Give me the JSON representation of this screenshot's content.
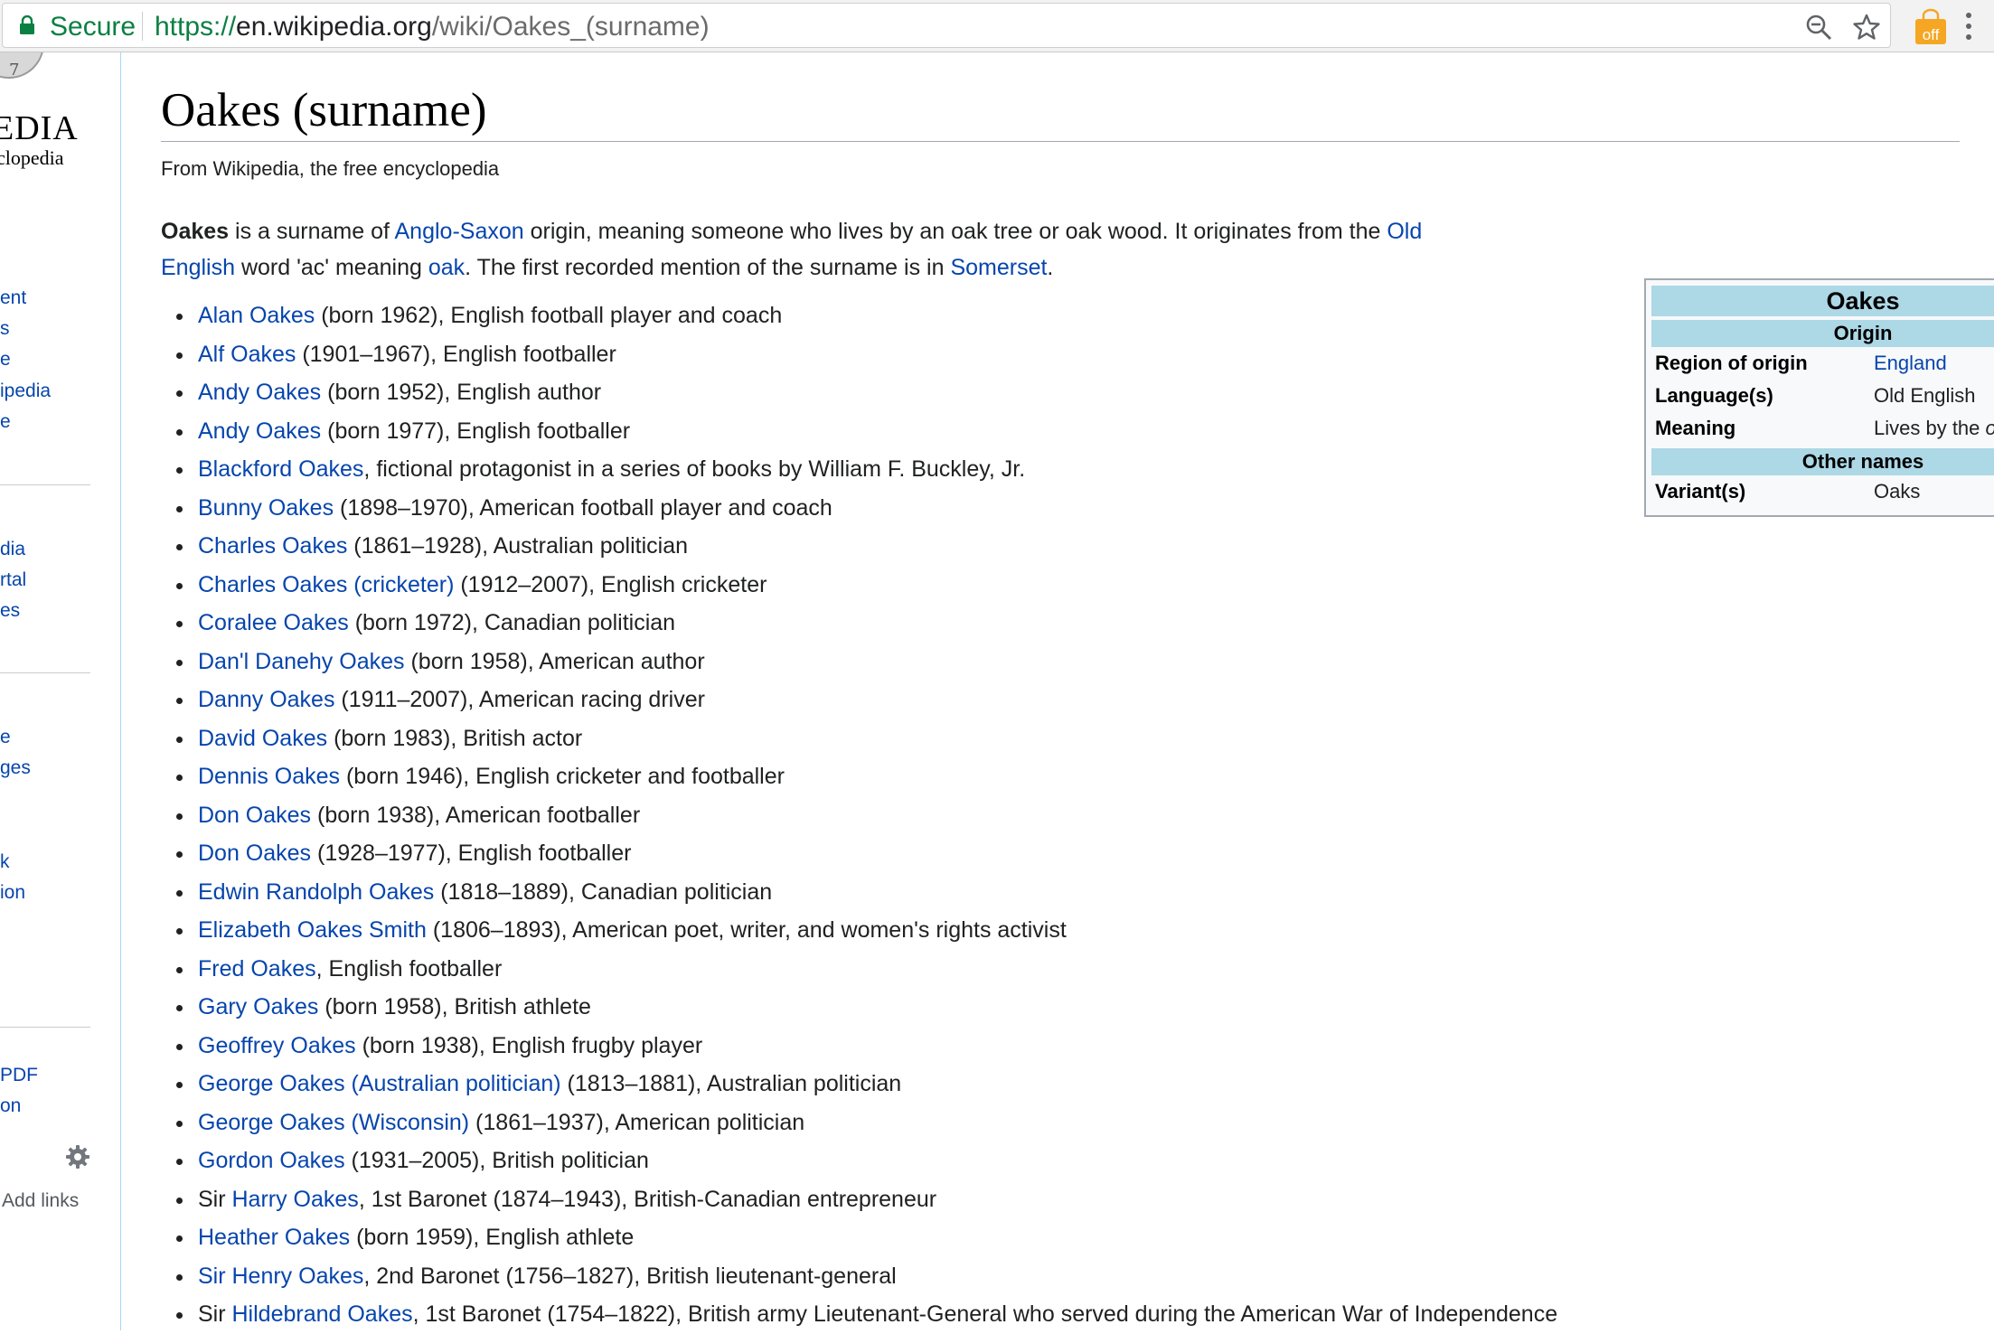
{
  "browser": {
    "secure_label": "Secure",
    "url_scheme": "https://",
    "url_host": "en.wikipedia.org",
    "url_path": "/wiki/Oakes_(surname)",
    "extension_badge": "off",
    "colors": {
      "secure": "#0b8043",
      "extension": "#f5a623"
    }
  },
  "sidebar": {
    "logo_word": "EDIA",
    "logo_tagline": "clopedia",
    "links": [
      "ent",
      "s",
      "e",
      "ipedia",
      "e",
      "dia",
      "rtal",
      "es",
      "e",
      "ges",
      "k",
      "ion",
      "PDF",
      "on"
    ],
    "grey_items": [
      "",
      "Add links"
    ]
  },
  "article": {
    "title": "Oakes (surname)",
    "site_sub": "From Wikipedia, the free encyclopedia",
    "intro": {
      "bold": "Oakes",
      "t1": " is a surname of ",
      "l1": "Anglo-Saxon",
      "t2": " origin, meaning someone who lives by an oak tree or oak wood. It originates from the ",
      "l2": "Old English",
      "t3": " word 'ac' meaning ",
      "l3": "oak",
      "t4": ". The first recorded mention of the surname is in ",
      "l4": "Somerset",
      "t5": "."
    },
    "people": [
      {
        "pre": "",
        "link": "Alan Oakes",
        "rest": " (born 1962), English football player and coach"
      },
      {
        "pre": "",
        "link": "Alf Oakes",
        "rest": " (1901–1967), English footballer"
      },
      {
        "pre": "",
        "link": "Andy Oakes",
        "rest": " (born 1952), English author"
      },
      {
        "pre": "",
        "link": "Andy Oakes",
        "rest": " (born 1977), English footballer"
      },
      {
        "pre": "",
        "link": "Blackford Oakes",
        "rest": ", fictional protagonist in a series of books by William F. Buckley, Jr."
      },
      {
        "pre": "",
        "link": "Bunny Oakes",
        "rest": " (1898–1970), American football player and coach"
      },
      {
        "pre": "",
        "link": "Charles Oakes",
        "rest": " (1861–1928), Australian politician"
      },
      {
        "pre": "",
        "link": "Charles Oakes (cricketer)",
        "rest": " (1912–2007), English cricketer"
      },
      {
        "pre": "",
        "link": "Coralee Oakes",
        "rest": " (born 1972), Canadian politician"
      },
      {
        "pre": "",
        "link": "Dan'l Danehy Oakes",
        "rest": " (born 1958), American author"
      },
      {
        "pre": "",
        "link": "Danny Oakes",
        "rest": " (1911–2007), American racing driver"
      },
      {
        "pre": "",
        "link": "David Oakes",
        "rest": " (born 1983), British actor"
      },
      {
        "pre": "",
        "link": "Dennis Oakes",
        "rest": " (born 1946), English cricketer and footballer"
      },
      {
        "pre": "",
        "link": "Don Oakes",
        "rest": " (born 1938), American footballer"
      },
      {
        "pre": "",
        "link": "Don Oakes",
        "rest": " (1928–1977), English footballer"
      },
      {
        "pre": "",
        "link": "Edwin Randolph Oakes",
        "rest": " (1818–1889), Canadian politician"
      },
      {
        "pre": "",
        "link": "Elizabeth Oakes Smith",
        "rest": " (1806–1893), American poet, writer, and women's rights activist"
      },
      {
        "pre": "",
        "link": "Fred Oakes",
        "rest": ", English footballer"
      },
      {
        "pre": "",
        "link": "Gary Oakes",
        "rest": " (born 1958), British athlete"
      },
      {
        "pre": "",
        "link": "Geoffrey Oakes",
        "rest": " (born 1938), English frugby player"
      },
      {
        "pre": "",
        "link": "George Oakes (Australian politician)",
        "rest": " (1813–1881), Australian politician"
      },
      {
        "pre": "",
        "link": "George Oakes (Wisconsin)",
        "rest": " (1861–1937), American politician"
      },
      {
        "pre": "",
        "link": "Gordon Oakes",
        "rest": " (1931–2005), British politician"
      },
      {
        "pre": "Sir ",
        "link": "Harry Oakes",
        "rest": ", 1st Baronet (1874–1943), British-Canadian entrepreneur"
      },
      {
        "pre": "",
        "link": "Heather Oakes",
        "rest": " (born 1959), English athlete"
      },
      {
        "pre": "",
        "link": "Sir Henry Oakes",
        "rest": ", 2nd Baronet (1756–1827), British lieutenant-general"
      },
      {
        "pre": "Sir ",
        "link": "Hildebrand Oakes",
        "rest": ", 1st Baronet (1754–1822), British army Lieutenant-General who served during the American War of Independence"
      }
    ],
    "link_color": "#0645ad"
  },
  "infobox": {
    "title": "Oakes",
    "section_origin": "Origin",
    "region_label": "Region of origin",
    "region_value": "England",
    "language_label": "Language(s)",
    "language_value": "Old English",
    "meaning_label": "Meaning",
    "meaning_value_pre": "Lives by the ",
    "meaning_value_em": "oak",
    "section_other": "Other names",
    "variant_label": "Variant(s)",
    "variant_value": "Oaks",
    "header_color": "#add8e6"
  }
}
